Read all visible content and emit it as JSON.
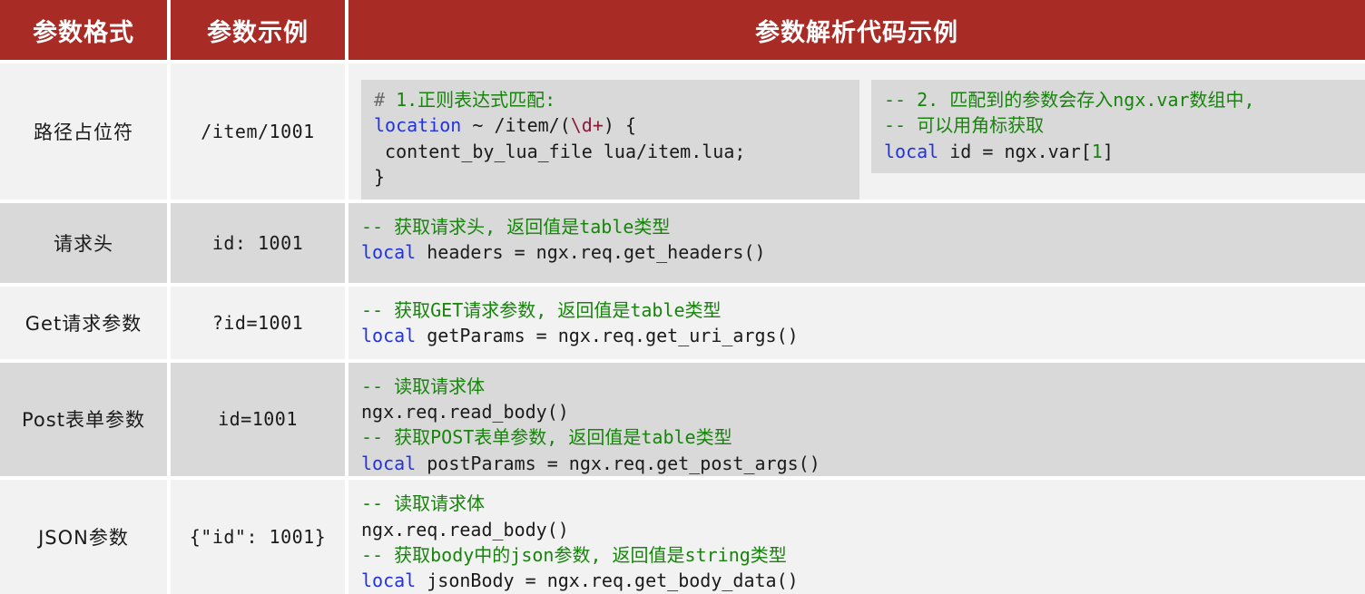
{
  "theme": {
    "header_bg": "#a82b26",
    "header_fg": "#ffffff",
    "row_light": "#f2f2f2",
    "row_dark": "#d9d9d9",
    "code_box_bg": "#d9d9d9",
    "comment_color": "#18830d",
    "keyword_color": "#2233dd",
    "escape_color": "#8b1a3a",
    "text_color": "#1a1a1a"
  },
  "header": {
    "col1": "参数格式",
    "col2": "参数示例",
    "col3": "参数解析代码示例"
  },
  "rows": [
    {
      "format": "路径占位符",
      "example": "/item/1001",
      "code_left": {
        "l1_hash": "# ",
        "l1_cmt": "1.正则表达式匹配:",
        "l2_kw": "location",
        "l2_a": " ~ /item/(",
        "l2_esc": "\\d+",
        "l2_b": ") {",
        "l3": " content_by_lua_file lua/item.lua;",
        "l4": "}"
      },
      "code_right": {
        "l1_cmt": "-- 2. 匹配到的参数会存入ngx.var数组中,",
        "l2_cmt": "-- 可以用角标获取",
        "l3_kw": "local",
        "l3_a": " id = ngx.var[",
        "l3_num": "1",
        "l3_b": "]"
      }
    },
    {
      "format": "请求头",
      "example": "id: 1001",
      "code": {
        "l1_cmt": "-- 获取请求头, 返回值是table类型",
        "l2_kw": "local",
        "l2_rest": " headers = ngx.req.get_headers()"
      }
    },
    {
      "format": "Get请求参数",
      "example": "?id=1001",
      "code": {
        "l1_cmt": "-- 获取GET请求参数, 返回值是table类型",
        "l2_kw": "local",
        "l2_rest": " getParams = ngx.req.get_uri_args()"
      }
    },
    {
      "format": "Post表单参数",
      "example": "id=1001",
      "code": {
        "l1_cmt": "-- 读取请求体",
        "l2_plain": "ngx.req.read_body()",
        "l3_cmt": "-- 获取POST表单参数, 返回值是table类型",
        "l4_kw": "local",
        "l4_rest": " postParams = ngx.req.get_post_args()"
      }
    },
    {
      "format": "JSON参数",
      "example": "{\"id\": 1001}",
      "code": {
        "l1_cmt": "-- 读取请求体",
        "l2_plain": "ngx.req.read_body()",
        "l3_cmt": "-- 获取body中的json参数, 返回值是string类型",
        "l4_kw": "local",
        "l4_rest": " jsonBody = ngx.req.get_body_data()"
      }
    }
  ]
}
